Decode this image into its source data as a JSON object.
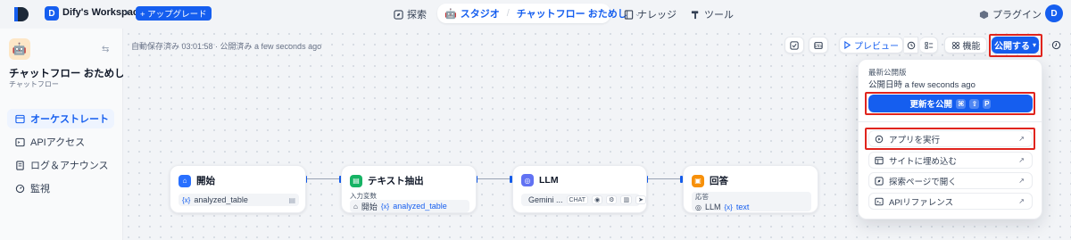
{
  "topbar": {
    "workspace_initial": "D",
    "workspace_name": "Dify's Workspace",
    "upgrade_label": "+ アップグレード",
    "nav": {
      "explore": "探索",
      "studio": "スタジオ",
      "current_app": "チャットフロー おためし",
      "knowledge": "ナレッジ",
      "tools": "ツール"
    },
    "plugins_label": "プラグイン",
    "user_initial": "D"
  },
  "sidebar": {
    "app_title": "チャットフロー おためし",
    "app_type": "チャットフロー",
    "items": [
      {
        "label": "オーケストレート",
        "icon": "orchestrate-icon",
        "active": true
      },
      {
        "label": "APIアクセス",
        "icon": "api-icon",
        "active": false
      },
      {
        "label": "ログ＆アナウンス",
        "icon": "logs-icon",
        "active": false
      },
      {
        "label": "監視",
        "icon": "monitor-icon",
        "active": false
      }
    ]
  },
  "canvas": {
    "autosave_text": "自動保存済み 03:01:58 · 公開済み a few seconds ago",
    "toolbar": {
      "preview_label": "プレビュー",
      "features_label": "機能",
      "publish_label": "公開する"
    }
  },
  "nodes": [
    {
      "title": "開始",
      "icon": "home-icon",
      "color": "#2970ff",
      "variable": "analyzed_table"
    },
    {
      "title": "テキスト抽出",
      "icon": "extract-icon",
      "color": "#16b364",
      "input_label": "入力変数",
      "source": "開始",
      "variable": "analyzed_table"
    },
    {
      "title": "LLM",
      "icon": "llm-icon",
      "color": "#6172f3",
      "model": "Gemini ...",
      "mode": "CHAT"
    },
    {
      "title": "回答",
      "icon": "answer-icon",
      "color": "#f79009",
      "response_label": "応答",
      "source": "LLM",
      "variable": "text"
    }
  ],
  "publish_menu": {
    "latest_label": "最新公開版",
    "published_time": "公開日時 a few seconds ago",
    "update_button": "更新を公開",
    "shortcut_keys": [
      "⌘",
      "⇧",
      "P"
    ],
    "items": [
      {
        "label": "アプリを実行",
        "icon": "play-icon"
      },
      {
        "label": "サイトに埋め込む",
        "icon": "embed-icon"
      },
      {
        "label": "探索ページで開く",
        "icon": "explore-icon"
      },
      {
        "label": "APIリファレンス",
        "icon": "api-reference-icon"
      }
    ]
  },
  "colors": {
    "primary": "#155eef",
    "highlight": "#e0241d"
  }
}
